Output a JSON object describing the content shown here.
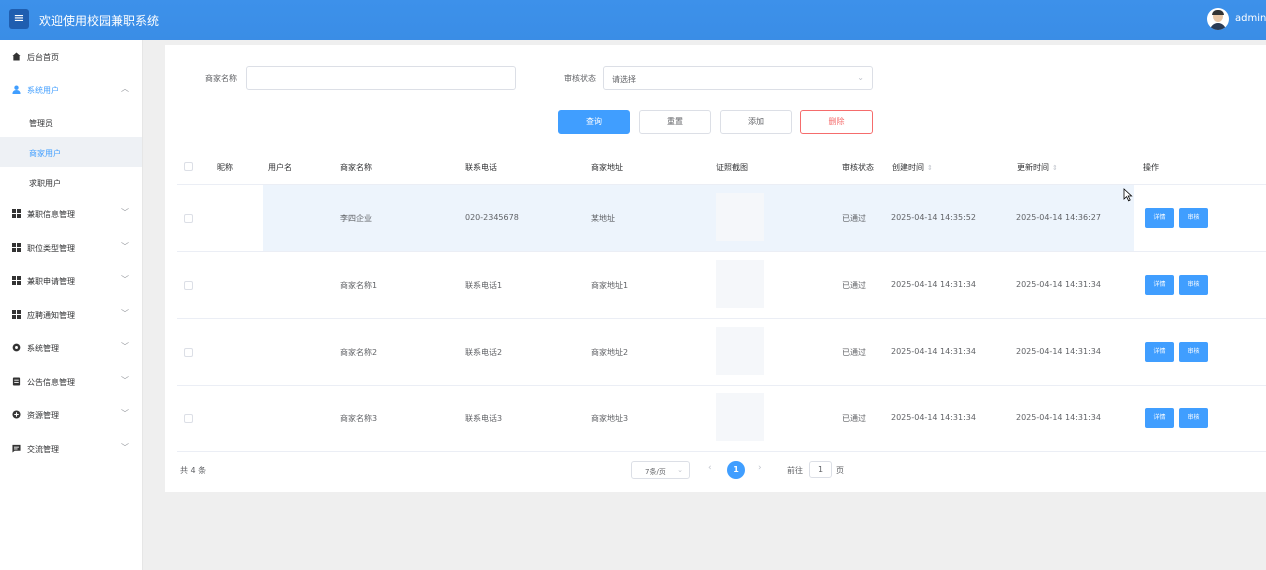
{
  "header": {
    "menu_icon": "hamburger-icon",
    "title": "欢迎使用校园兼职系统",
    "user": "admin"
  },
  "sidebar": {
    "items": [
      {
        "label": "后台首页",
        "icon": "home-icon"
      },
      {
        "label": "系统用户",
        "icon": "user-icon",
        "expanded": true,
        "children": [
          {
            "label": "管理员"
          },
          {
            "label": "商家用户",
            "selected": true
          },
          {
            "label": "求职用户"
          }
        ]
      },
      {
        "label": "兼职信息管理",
        "icon": "grid-icon"
      },
      {
        "label": "职位类型管理",
        "icon": "grid-icon"
      },
      {
        "label": "兼职申请管理",
        "icon": "grid-icon"
      },
      {
        "label": "应聘通知管理",
        "icon": "grid-icon"
      },
      {
        "label": "系统管理",
        "icon": "gear-icon"
      },
      {
        "label": "公告信息管理",
        "icon": "document-icon"
      },
      {
        "label": "资源管理",
        "icon": "plus-circle-icon"
      },
      {
        "label": "交流管理",
        "icon": "chat-icon"
      }
    ]
  },
  "search": {
    "name_label": "商家名称",
    "name_value": "",
    "status_label": "审核状态",
    "status_placeholder": "请选择"
  },
  "actions": {
    "query": "查询",
    "reset": "重置",
    "add": "添加",
    "delete": "删除"
  },
  "table": {
    "headers": {
      "nickname": "昵称",
      "username": "用户名",
      "merchant_name": "商家名称",
      "phone": "联系电话",
      "address": "商家地址",
      "license": "证照截图",
      "status": "审核状态",
      "created": "创建时间",
      "updated": "更新时间",
      "ops": "操作"
    },
    "sort_icon": "⇕",
    "rows": [
      {
        "nickname": "",
        "username": "",
        "merchant_name": "李四企业",
        "phone": "020-2345678",
        "address": "某地址",
        "status": "已通过",
        "created": "2025-04-14 14:35:52",
        "updated": "2025-04-14 14:36:27",
        "detail": "详情",
        "review": "审核"
      },
      {
        "nickname": "",
        "username": "",
        "merchant_name": "商家名称1",
        "phone": "联系电话1",
        "address": "商家地址1",
        "status": "已通过",
        "created": "2025-04-14 14:31:34",
        "updated": "2025-04-14 14:31:34",
        "detail": "详情",
        "review": "审核"
      },
      {
        "nickname": "",
        "username": "",
        "merchant_name": "商家名称2",
        "phone": "联系电话2",
        "address": "商家地址2",
        "status": "已通过",
        "created": "2025-04-14 14:31:34",
        "updated": "2025-04-14 14:31:34",
        "detail": "详情",
        "review": "审核"
      },
      {
        "nickname": "",
        "username": "",
        "merchant_name": "商家名称3",
        "phone": "联系电话3",
        "address": "商家地址3",
        "status": "已通过",
        "created": "2025-04-14 14:31:34",
        "updated": "2025-04-14 14:31:34",
        "detail": "详情",
        "review": "审核"
      }
    ]
  },
  "pagination": {
    "total": "共 4 条",
    "page_size": "7条/页",
    "current_page": "1",
    "goto_label": "前往",
    "goto_value": "1",
    "page_unit": "页"
  },
  "colors": {
    "primary": "#409eff",
    "danger": "#f56c6c",
    "header_bg": "#3a8ee6"
  }
}
